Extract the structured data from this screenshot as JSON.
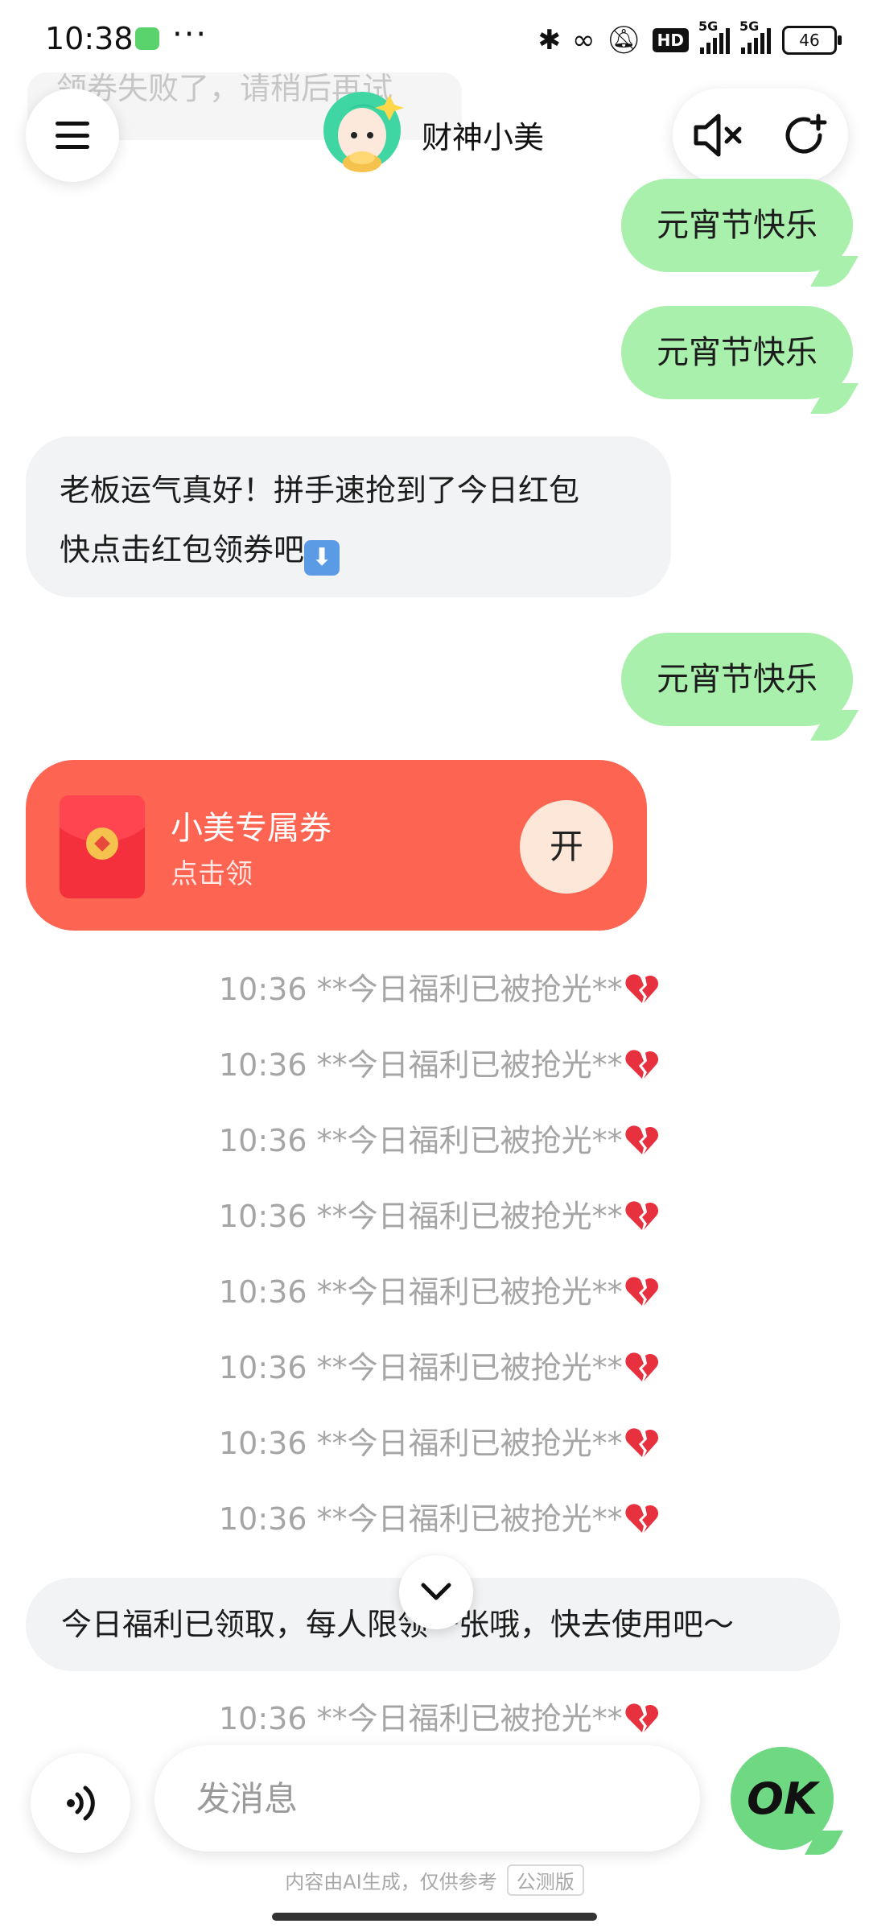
{
  "status_bar": {
    "time": "10:38",
    "more": "···",
    "hd": "HD",
    "signal1": "5G",
    "signal2": "5G",
    "battery": "46"
  },
  "ghost_message": "领券失败了，请稍后再试",
  "header": {
    "bot_name": "财神小美",
    "menu_icon": "hamburger-icon",
    "mute_icon": "speaker-muted-icon",
    "new_chat_icon": "refresh-plus-icon"
  },
  "messages": [
    {
      "type": "user",
      "text": "元宵节快乐"
    },
    {
      "type": "user",
      "text": "元宵节快乐"
    },
    {
      "type": "bot",
      "line1": "老板运气真好！拼手速抢到了今日红包",
      "line2": "快点击红包领券吧"
    },
    {
      "type": "user",
      "text": "元宵节快乐"
    }
  ],
  "red_packet": {
    "title": "小美专属券",
    "subtitle": "点击领",
    "open_label": "开"
  },
  "system_messages": [
    "10:36 **今日福利已被抢光**",
    "10:36 **今日福利已被抢光**",
    "10:36 **今日福利已被抢光**",
    "10:36 **今日福利已被抢光**",
    "10:36 **今日福利已被抢光**",
    "10:36 **今日福利已被抢光**",
    "10:36 **今日福利已被抢光**",
    "10:36 **今日福利已被抢光**",
    "10:36 **今日福利已被抢光**"
  ],
  "notice": "今日福利已领取，每人限领一张哦，快去使用吧～",
  "composer": {
    "placeholder": "发消息",
    "voice_icon": "voice-wave-icon",
    "ok_label": "OK"
  },
  "footer": {
    "note": "内容由AI生成，仅供参考",
    "beta": "公测版"
  },
  "colors": {
    "user_bubble": "#a9f0ad",
    "bot_bubble": "#f2f3f4",
    "red_packet": "#fe6452",
    "ok_button": "#6ed882"
  }
}
